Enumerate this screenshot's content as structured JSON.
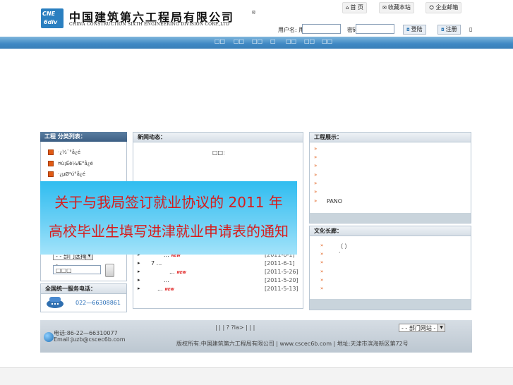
{
  "header": {
    "logo_text_left": "CNE",
    "logo_text_right": "6div",
    "company_cn": "中国建筑第六工程局有限公司",
    "company_en": "CHINA CONSTRUCTION SIXTH ENGINEERING DIVISION CORP.,LTD",
    "logo_extra": "®",
    "links": [
      {
        "label": "首 页",
        "icon": "home-icon"
      },
      {
        "label": "收藏本站",
        "icon": "mail-icon"
      },
      {
        "label": "企业邮箱",
        "icon": "user-icon"
      }
    ],
    "login": {
      "user_label": "用户名: 用户",
      "pass_label": "密码",
      "login_button": "登陆",
      "register_button": "注册",
      "trail": "▯"
    }
  },
  "nav": {
    "items": [
      "□□",
      "□□",
      "□□",
      "□",
      "□□",
      "□□",
      "□□"
    ]
  },
  "left": {
    "categories_title": "工程 分类列表：",
    "categories": [
      "·¿½¨°å¿é",
      "¤ù¡Éè¼Æ°å¿é",
      "·¿µØ²ú°å¿é"
    ],
    "dept_select": "- - 部门选择 - -",
    "search_value": "□□□",
    "service_title": "全国统一服务电话：",
    "service_phone": "022—66308861"
  },
  "news": {
    "title": "新闻动态：",
    "top_text": "□□:",
    "items": [
      {
        "title": "...",
        "new": "NEW",
        "date": "[2011-6-1]"
      },
      {
        "title": "7 ...",
        "new": "",
        "date": "[2011-6-1]"
      },
      {
        "title": "...",
        "new": "NEW",
        "date": "[2011-5-26]"
      },
      {
        "title": "...",
        "new": "",
        "date": "[2011-5-20]"
      },
      {
        "title": "...",
        "new": "NEW",
        "date": "[2011-5-13]"
      }
    ]
  },
  "banner": {
    "line1": "关于与我局签订就业协议的 2011 年",
    "line2": "高校毕业生填写进津就业申请表的通知"
  },
  "projects": {
    "title": "工程展示：",
    "items": [
      "",
      "",
      "",
      "",
      "",
      "",
      "PANO"
    ]
  },
  "culture": {
    "title": "文化长廊：",
    "items": [
      "（ ）",
      "·",
      "",
      "",
      "",
      ""
    ]
  },
  "footer": {
    "contact": "电话:86-22—66310077",
    "email": "Email:juzb@cscec6b.com",
    "links": "|    |    |  ? ?la> |    |    |",
    "copyright": "版权所有:中国建筑第六工程局有限公司 | www.cscec6b.com | 地址:天津市滨海新区第72号",
    "dept_select": "- - 部门网站 - -"
  }
}
